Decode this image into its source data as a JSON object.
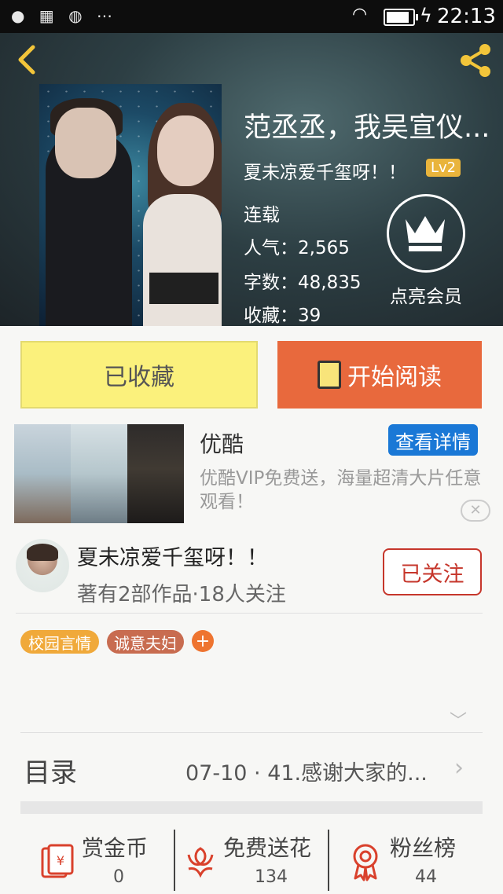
{
  "status_bar": {
    "time": "22:13"
  },
  "book": {
    "title": "范丞丞，我吴宣仪...",
    "author": "夏未凉爱千玺呀！！",
    "author_level": "Lv2",
    "status": "连载",
    "popularity_label": "人气：",
    "popularity": "2,565",
    "word_count_label": "字数：",
    "word_count": "48,835",
    "favorites_label": "收藏：",
    "favorites": "39",
    "vip_label": "点亮会员"
  },
  "actions": {
    "favorited_label": "已收藏",
    "read_label": "开始阅读"
  },
  "ad": {
    "title": "优酷",
    "button": "查看详情",
    "description": "优酷VIP免费送，海量超清大片任意观看！",
    "close": "✕"
  },
  "author_card": {
    "name": "夏未凉爱千玺呀！！",
    "meta": "著有2部作品·18人关注",
    "follow_label": "已关注"
  },
  "tags": [
    {
      "label": "校园言情",
      "color": "#f0a93a"
    },
    {
      "label": "诚意夫妇",
      "color": "#c86c50"
    }
  ],
  "tag_add": "+",
  "toc": {
    "label": "目录",
    "latest": "07-10 · 41.感谢大家的...",
    "arrow": "›",
    "expand": "﹀"
  },
  "bottom_bar": [
    {
      "label": "赏金币",
      "value": "0",
      "icon": "coin-card-icon"
    },
    {
      "label": "免费送花",
      "value": "134",
      "icon": "flower-icon"
    },
    {
      "label": "粉丝榜",
      "value": "44",
      "icon": "medal-icon"
    }
  ],
  "colors": {
    "accent": "#e8693d",
    "favorite_bg": "#fbf17c",
    "follow": "#c6362b",
    "link_blue": "#1a78d6",
    "icon_red": "#d9412c"
  }
}
